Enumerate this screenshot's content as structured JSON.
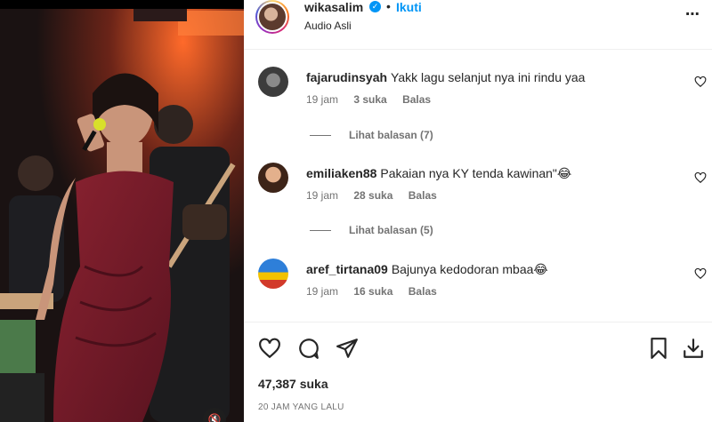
{
  "post": {
    "username": "wikasalim",
    "follow_label": "Ikuti",
    "separator": "•",
    "audio": "Audio Asli",
    "more_icon": "more-horizontal-icon",
    "verified_icon": "verified-badge-icon"
  },
  "comments": [
    {
      "user": "fajarudinsyah",
      "text": "Yakk lagu selanjut nya ini rindu yaa",
      "time": "19 jam",
      "likes": "3 suka",
      "reply": "Balas",
      "view_replies": "Lihat balasan (7)"
    },
    {
      "user": "emiliaken88",
      "text": "Pakaian nya KY tenda kawinan\"😂",
      "time": "19 jam",
      "likes": "28 suka",
      "reply": "Balas",
      "view_replies": "Lihat balasan (5)"
    },
    {
      "user": "aref_tirtana09",
      "text": "Bajunya kedodoran mbaa😂",
      "time": "19 jam",
      "likes": "16 suka",
      "reply": "Balas"
    }
  ],
  "footer": {
    "likes": "47,387 suka",
    "timestamp": "20 JAM YANG LALU",
    "icons": [
      "heart-icon",
      "comment-icon",
      "share-icon",
      "bookmark-icon",
      "download-icon"
    ]
  },
  "media": {
    "mute_icon": "🔇"
  },
  "colors": {
    "accent": "#0095f6",
    "muted_text": "#737373",
    "primary_text": "#262626",
    "divider": "#efefef"
  }
}
